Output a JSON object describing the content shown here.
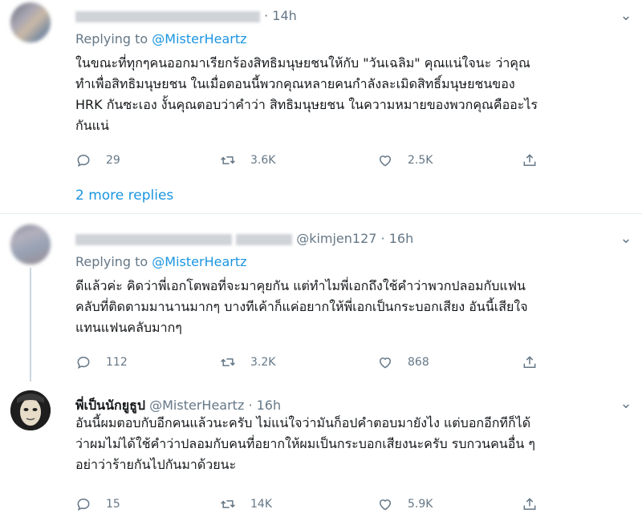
{
  "tweets": [
    {
      "time": "14h",
      "replying_label": "Replying to",
      "replying_to": "@MisterHeartz",
      "lines": [
        "ในขณะที่ทุกๆคนออกมาเรียกร้องสิทธิมนุษยชนให้กับ \"วันเฉลิม\" คุณแน่ใจนะ ว่าคุณ",
        "ทำเพื่อสิทธิมนุษยชน ในเมื่อตอนนี้พวกคุณหลายคนกำลังละเมิดสิทธิ์มนุษยชนของ",
        "HRK กันซะเอง งั้นคุณตอบว่าคำว่า สิทธิมนุษยชน ในความหมายของพวกคุณคืออะไร",
        "กันแน่"
      ],
      "replies": "29",
      "retweets": "3.6K",
      "likes": "2.5K"
    },
    {
      "handle": "@kimjen127",
      "time": "16h",
      "replying_label": "Replying to",
      "replying_to": "@MisterHeartz",
      "lines": [
        "ดีแล้วค่ะ คิดว่าพี่เอกโตพอที่จะมาคุยกัน แต่ทำไมพี่เอกถึงใช้คำว่าพวกปลอมกับแฟน",
        "คลับที่ติดตามมานานมากๆ บางทีเค้าก็แค่อยากให้พี่เอกเป็นกระบอกเสียง อันนี้เสียใจ",
        "แทนแฟนคลับมากๆ"
      ],
      "replies": "112",
      "retweets": "3.2K",
      "likes": "868"
    },
    {
      "name": "พี่เป็นนักยูธูป",
      "handle": "@MisterHeartz",
      "time": "16h",
      "lines": [
        "อันนี้ผมตอบกับอีกคนแล้วนะครับ ไม่แน่ใจว่ามันก็อปคำตอบมายังไง แต่บอกอีกทีก็ได้",
        "ว่าผมไม่ได้ใช้คำว่าปลอมกับคนที่อยากให้ผมเป็นกระบอกเสียงนะครับ รบกวนคนอื่น ๆ",
        "อย่าว่าร้ายกันไปกันมาด้วยนะ"
      ],
      "replies": "15",
      "retweets": "14K",
      "likes": "5.9K"
    }
  ],
  "more_replies": "2 more replies",
  "separator": "·",
  "icons": {
    "reply": "reply-icon",
    "retweet": "retweet-icon",
    "like": "heart-icon",
    "share": "share-icon",
    "more": "chevron-down-icon"
  },
  "colors": {
    "link": "#1b95e0",
    "muted": "#657786",
    "text": "#14171a"
  }
}
